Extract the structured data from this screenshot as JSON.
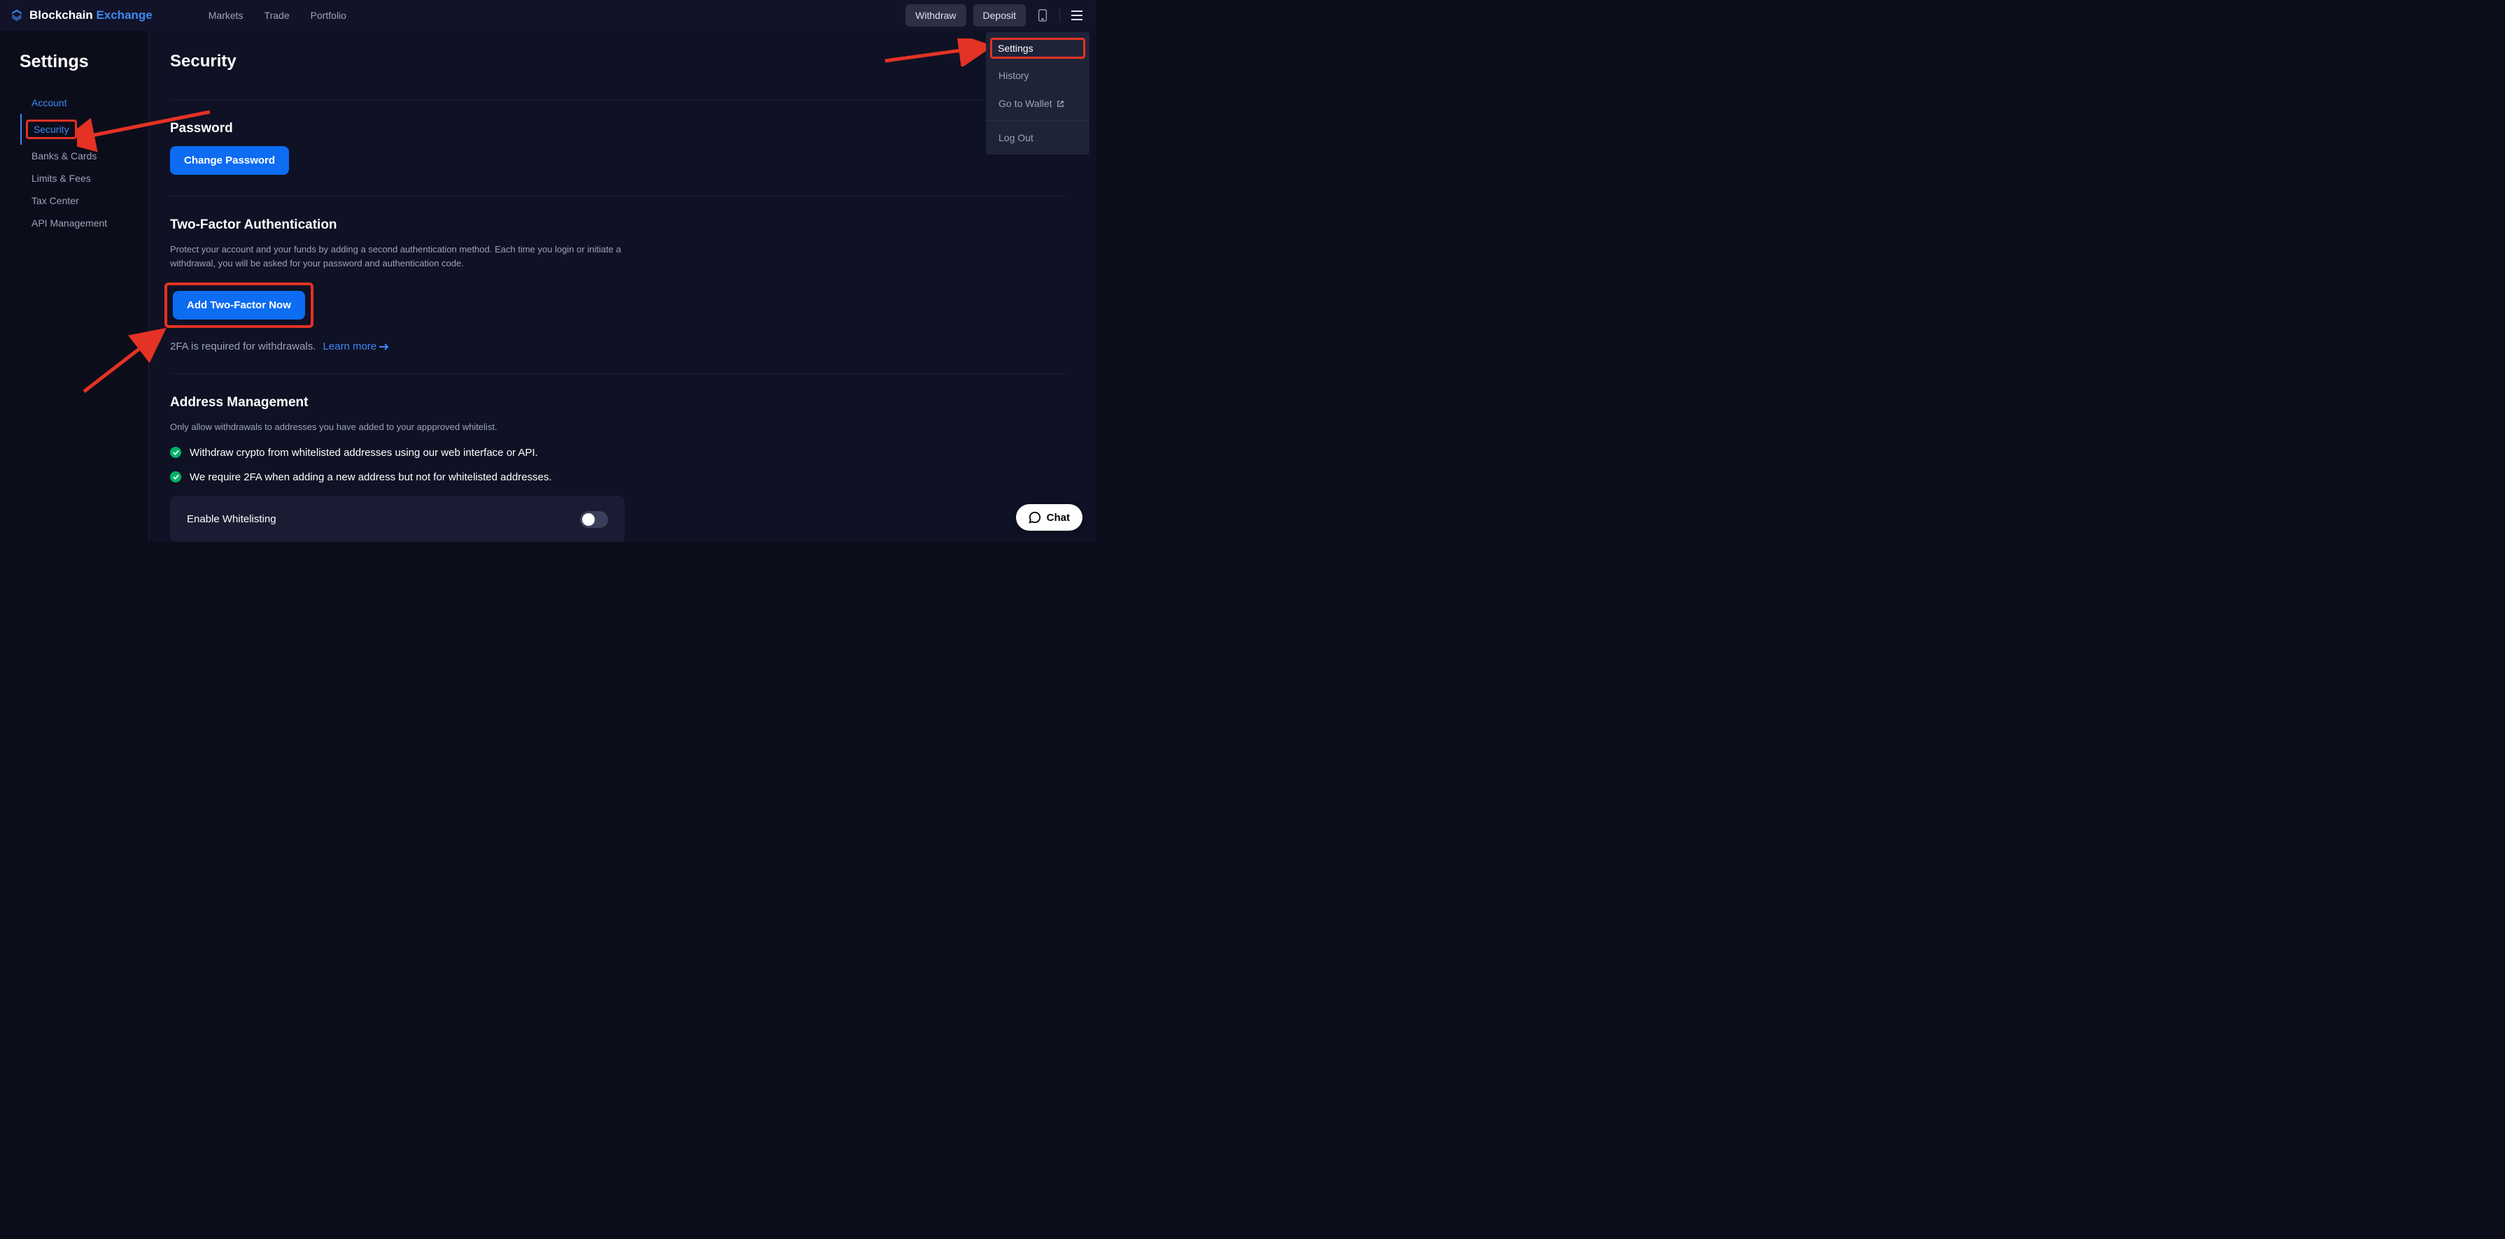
{
  "brand": {
    "name1": "Blockchain",
    "name2": "Exchange"
  },
  "nav": {
    "markets": "Markets",
    "trade": "Trade",
    "portfolio": "Portfolio"
  },
  "topbar": {
    "withdraw": "Withdraw",
    "deposit": "Deposit"
  },
  "dropdown": {
    "settings": "Settings",
    "history": "History",
    "wallet": "Go to Wallet",
    "logout": "Log Out"
  },
  "sidebar": {
    "title": "Settings",
    "items": {
      "account": "Account",
      "security": "Security",
      "banks": "Banks & Cards",
      "limits": "Limits & Fees",
      "tax": "Tax Center",
      "api": "API Management"
    }
  },
  "page": {
    "title": "Security",
    "password": {
      "title": "Password",
      "button": "Change Password"
    },
    "twofa": {
      "title": "Two-Factor Authentication",
      "desc": "Protect your account and your funds by adding a second authentication method. Each time you login or initiate a withdrawal, you will be asked for your password and authentication code.",
      "button": "Add Two-Factor Now",
      "note": "2FA is required for withdrawals.",
      "learn": "Learn more"
    },
    "address": {
      "title": "Address Management",
      "desc": "Only allow withdrawals to addresses you have added to your appproved whitelist.",
      "bullet1": "Withdraw crypto from whitelisted addresses using our web interface or API.",
      "bullet2": "We require 2FA when adding a new address but not for whitelisted addresses.",
      "toggle": "Enable Whitelisting"
    }
  },
  "chat": {
    "label": "Chat"
  }
}
